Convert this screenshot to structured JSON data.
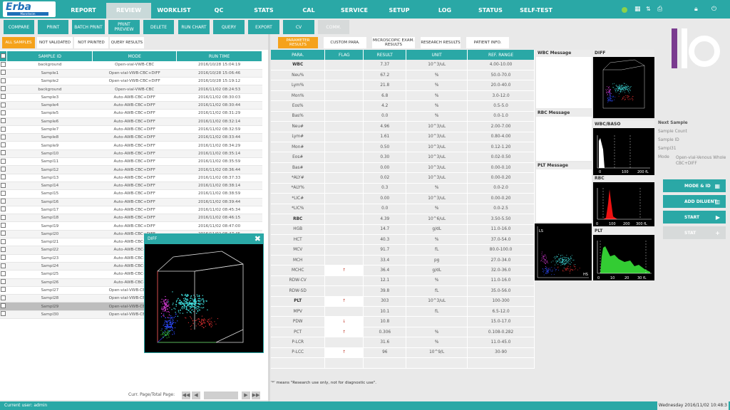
{
  "app": {
    "logo_text": "Erba",
    "logo_sub": "Mannheim"
  },
  "nav": [
    {
      "label": "REPORT"
    },
    {
      "label": "REVIEW"
    },
    {
      "label": "WORKLIST"
    },
    {
      "label": "QC"
    },
    {
      "label": "STATS"
    },
    {
      "label": "CAL"
    },
    {
      "label": "SERVICE"
    },
    {
      "label": "SETUP"
    },
    {
      "label": "LOG"
    },
    {
      "label": "STATUS"
    },
    {
      "label": "SELF-TEST"
    }
  ],
  "toolbar": [
    {
      "label": "COMPARE"
    },
    {
      "label": "PRINT"
    },
    {
      "label": "BATCH PRINT"
    },
    {
      "label": "PRINT PREVIEW"
    },
    {
      "label": "DELETE"
    },
    {
      "label": "RUN CHART"
    },
    {
      "label": "QUERY"
    },
    {
      "label": "EXPORT"
    },
    {
      "label": "CV"
    },
    {
      "label": "COMM."
    }
  ],
  "left_tabs": [
    {
      "label": "ALL SAMPLES"
    },
    {
      "label": "NOT VALIDATED"
    },
    {
      "label": "NOT PRINTED"
    },
    {
      "label": "QUERY RESULTS"
    }
  ],
  "right_tabs": [
    {
      "label": "PARAMETER RESULTS"
    },
    {
      "label": "CUSTOM PARA."
    },
    {
      "label": "MICROSCOPIC EXAM. RESULTS"
    },
    {
      "label": "RESEARCH RESULTS"
    },
    {
      "label": "PATIENT INFO."
    }
  ],
  "sample_table": {
    "headers": [
      "SAMPLE ID",
      "MODE",
      "RUN TIME"
    ],
    "rows": [
      [
        "background",
        "Open-vial-VWB-CBC",
        "2016/10/28 15:04:19"
      ],
      [
        "Sample1",
        "Open-vial-VWB-CBC+DIFF",
        "2016/10/28 15:06:46"
      ],
      [
        "Sample2",
        "Open-vial-VWB-CBC+DIFF",
        "2016/10/28 15:19:12"
      ],
      [
        "background",
        "Open-vial-VWB-CBC",
        "2016/11/02 08:24:53"
      ],
      [
        "Sample3",
        "Auto-AWB-CBC+DIFF",
        "2016/11/02 08:30:03"
      ],
      [
        "Sample4",
        "Auto-AWB-CBC+DIFF",
        "2016/11/02 08:30:44"
      ],
      [
        "Sample5",
        "Auto-AWB-CBC+DIFF",
        "2016/11/02 08:31:29"
      ],
      [
        "Sample6",
        "Auto-AWB-CBC+DIFF",
        "2016/11/02 08:32:14"
      ],
      [
        "Sample7",
        "Auto-AWB-CBC+DIFF",
        "2016/11/02 08:32:59"
      ],
      [
        "Sample8",
        "Auto-AWB-CBC+DIFF",
        "2016/11/02 08:33:44"
      ],
      [
        "Sample9",
        "Auto-AWB-CBC+DIFF",
        "2016/11/02 08:34:29"
      ],
      [
        "Sampl10",
        "Auto-AWB-CBC+DIFF",
        "2016/11/02 08:35:14"
      ],
      [
        "Sampl11",
        "Auto-AWB-CBC+DIFF",
        "2016/11/02 08:35:59"
      ],
      [
        "Sampl12",
        "Auto-AWB-CBC+DIFF",
        "2016/11/02 08:36:44"
      ],
      [
        "Sampl13",
        "Auto-AWB-CBC+DIFF",
        "2016/11/02 08:37:33"
      ],
      [
        "Sampl14",
        "Auto-AWB-CBC+DIFF",
        "2016/11/02 08:38:14"
      ],
      [
        "Sampl15",
        "Auto-AWB-CBC+DIFF",
        "2016/11/02 08:38:59"
      ],
      [
        "Sampl16",
        "Auto-AWB-CBC+DIFF",
        "2016/11/02 08:39:44"
      ],
      [
        "Sampl17",
        "Auto-AWB-CBC+DIFF",
        "2016/11/02 08:45:34"
      ],
      [
        "Sampl18",
        "Auto-AWB-CBC+DIFF",
        "2016/11/02 08:46:15"
      ],
      [
        "Sampl19",
        "Auto-AWB-CBC+DIFF",
        "2016/11/02 08:47:00"
      ],
      [
        "Sampl20",
        "Auto-AWB-CBC+DIFF",
        "2016/11/02 08:47:45"
      ],
      [
        "Sampl21",
        "Auto-AWB-CBC+DIFF",
        ""
      ],
      [
        "Sampl22",
        "Auto-AWB-CBC+DIFF",
        ""
      ],
      [
        "Sampl23",
        "Auto-AWB-CBC+DIFF",
        ""
      ],
      [
        "Sampl24",
        "Auto-AWB-CBC+DIFF",
        ""
      ],
      [
        "Sampl25",
        "Auto-AWB-CBC+DIFF",
        ""
      ],
      [
        "Sampl26",
        "Auto-AWB-CBC+DIFF",
        ""
      ],
      [
        "Sampl27",
        "Open-vial-VWB-CBC+DIFF",
        ""
      ],
      [
        "Sampl28",
        "Open-vial-VWB-CBC+DIFF",
        ""
      ],
      [
        "Sampl29",
        "Open-vial-VWB-CBC+DIFF",
        ""
      ],
      [
        "Sampl30",
        "Open-vial-VWB-CBC+DIFF",
        ""
      ]
    ],
    "selected_row": 30
  },
  "pager": {
    "label": "Curr. Page/Total Page:"
  },
  "popup": {
    "title": "DIFF",
    "close": "✖"
  },
  "results_table": {
    "headers": [
      "PARA.",
      "FLAG",
      "RESULT",
      "UNIT",
      "REF. RANGE"
    ],
    "rows": [
      {
        "para": "WBC",
        "flag": "",
        "result": "7.37",
        "unit": "10^3/uL",
        "ref": "4.00-10.00",
        "bold": true
      },
      {
        "para": "Neu%",
        "flag": "",
        "result": "67.2",
        "unit": "%",
        "ref": "50.0-70.0"
      },
      {
        "para": "Lym%",
        "flag": "",
        "result": "21.8",
        "unit": "%",
        "ref": "20.0-40.0"
      },
      {
        "para": "Mon%",
        "flag": "",
        "result": "6.8",
        "unit": "%",
        "ref": "3.0-12.0"
      },
      {
        "para": "Eos%",
        "flag": "",
        "result": "4.2",
        "unit": "%",
        "ref": "0.5-5.0"
      },
      {
        "para": "Bas%",
        "flag": "",
        "result": "0.0",
        "unit": "%",
        "ref": "0.0-1.0"
      },
      {
        "para": "Neu#",
        "flag": "",
        "result": "4.96",
        "unit": "10^3/uL",
        "ref": "2.00-7.00"
      },
      {
        "para": "Lym#",
        "flag": "",
        "result": "1.61",
        "unit": "10^3/uL",
        "ref": "0.80-4.00"
      },
      {
        "para": "Mon#",
        "flag": "",
        "result": "0.50",
        "unit": "10^3/uL",
        "ref": "0.12-1.20"
      },
      {
        "para": "Eos#",
        "flag": "",
        "result": "0.30",
        "unit": "10^3/uL",
        "ref": "0.02-0.50"
      },
      {
        "para": "Bas#",
        "flag": "",
        "result": "0.00",
        "unit": "10^3/uL",
        "ref": "0.00-0.10"
      },
      {
        "para": "*ALY#",
        "flag": "",
        "result": "0.02",
        "unit": "10^3/uL",
        "ref": "0.00-0.20"
      },
      {
        "para": "*ALY%",
        "flag": "",
        "result": "0.3",
        "unit": "%",
        "ref": "0.0-2.0"
      },
      {
        "para": "*LIC#",
        "flag": "",
        "result": "0.00",
        "unit": "10^3/uL",
        "ref": "0.00-0.20"
      },
      {
        "para": "*LIC%",
        "flag": "",
        "result": "0.0",
        "unit": "%",
        "ref": "0.0-2.5"
      },
      {
        "para": "RBC",
        "flag": "",
        "result": "4.39",
        "unit": "10^6/uL",
        "ref": "3.50-5.50",
        "bold": true
      },
      {
        "para": "HGB",
        "flag": "",
        "result": "14.7",
        "unit": "g/dL",
        "ref": "11.0-16.0"
      },
      {
        "para": "HCT",
        "flag": "",
        "result": "40.3",
        "unit": "%",
        "ref": "37.0-54.0"
      },
      {
        "para": "MCV",
        "flag": "",
        "result": "91.7",
        "unit": "fL",
        "ref": "80.0-100.0"
      },
      {
        "para": "MCH",
        "flag": "",
        "result": "33.4",
        "unit": "pg",
        "ref": "27.0-34.0"
      },
      {
        "para": "MCHC",
        "flag": "↑",
        "result": "36.4",
        "unit": "g/dL",
        "ref": "32.0-36.0"
      },
      {
        "para": "RDW-CV",
        "flag": "",
        "result": "12.1",
        "unit": "%",
        "ref": "11.0-16.0"
      },
      {
        "para": "RDW-SD",
        "flag": "",
        "result": "39.8",
        "unit": "fL",
        "ref": "35.0-56.0"
      },
      {
        "para": "PLT",
        "flag": "↑",
        "result": "303",
        "unit": "10^3/uL",
        "ref": "100-300",
        "bold": true
      },
      {
        "para": "MPV",
        "flag": "",
        "result": "10.1",
        "unit": "fL",
        "ref": "6.5-12.0"
      },
      {
        "para": "PDW",
        "flag": "↓",
        "result": "10.8",
        "unit": "",
        "ref": "15.0-17.0"
      },
      {
        "para": "PCT",
        "flag": "↑",
        "result": "0.306",
        "unit": "%",
        "ref": "0.108-0.282"
      },
      {
        "para": "P-LCR",
        "flag": "",
        "result": "31.6",
        "unit": "%",
        "ref": "11.0-45.0"
      },
      {
        "para": "P-LCC",
        "flag": "↑",
        "result": "96",
        "unit": "10^9/L",
        "ref": "30-90"
      },
      {
        "para": "",
        "flag": "",
        "result": "",
        "unit": "",
        "ref": ""
      }
    ]
  },
  "research_note": "'*' means \"Research use only, not for diagnostic use\".",
  "messages": {
    "wbc": "WBC Message",
    "rbc": "RBC Message",
    "plt": "PLT Message"
  },
  "plots": {
    "diff": "DIFF",
    "baso": "WBC/BASO",
    "rbc": "RBC",
    "plt": "PLT",
    "ls": "LS",
    "hs": "HS",
    "baso_ticks": [
      "0",
      "100",
      "200 fL"
    ],
    "rbc_ticks": [
      "0",
      "100",
      "200",
      "300 fL"
    ],
    "plt_ticks": [
      "0",
      "10",
      "20",
      "30 fL"
    ]
  },
  "next_sample": {
    "title": "Next Sample",
    "count_label": "Sample Count",
    "id_label": "Sample ID",
    "id_value": "Sampl31",
    "mode_label": "Mode",
    "mode_value": "Open-vial-Venous Whole CBC+DIFF"
  },
  "right_buttons": [
    {
      "label": "MODE & ID",
      "icon": "▦"
    },
    {
      "label": "ADD DILUENT",
      "icon": "▥"
    },
    {
      "label": "START",
      "icon": "▶"
    },
    {
      "label": "STAT",
      "icon": "+"
    }
  ],
  "status_bar": {
    "user": "Current user: admin",
    "datetime": "Wednesday 2016/11/02 10:48:3"
  },
  "brand": {
    "accent": "#2aa8a6",
    "orange": "#f5a21b",
    "logo_purple": "#7a3b8f"
  }
}
